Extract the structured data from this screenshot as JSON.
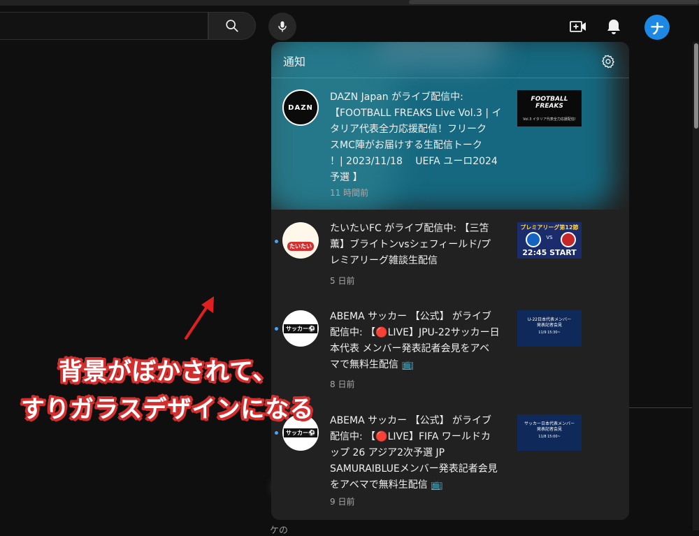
{
  "header": {
    "search_icon": "search-icon",
    "mic_icon": "mic-icon",
    "create_icon": "video-plus-icon",
    "bell_icon": "bell-icon",
    "avatar_initial": "ナ",
    "avatar_color": "#1e88e5"
  },
  "panel": {
    "title": "通知",
    "settings_icon": "gear-icon",
    "notifications": [
      {
        "text": "DAZN Japan がライブ配信中:\n【FOOTBALL FREAKS Live Vol.3 | イ\nタリア代表全力応援配信！フリーク\nスMC陣がお届けする生配信トーク\n！| 2023/11/18　 UEFA ユーロ2024\n予選 】",
        "time": "11 時間前",
        "unread": false,
        "avatar_text": "DAZN",
        "thumb_title": "FOOTBALL\nFREAKS",
        "thumb_sub": "Vol.3 イタリア代表全力応援配信!"
      },
      {
        "text": "たいたいFC がライブ配信中: 【三笘\n薫】ブライトンvsシェフィールド/プ\nレミアリーグ雑談生配信",
        "time": "5 日前",
        "unread": true,
        "avatar_text": "たいたい",
        "thumb_title": "プレミアリーグ第12節",
        "thumb_sub": "22:45 START",
        "thumb_vs": "VS"
      },
      {
        "text": "ABEMA サッカー 【公式】 がライブ\n配信中: 【🔴LIVE】JPU-22サッカー日\n本代表 メンバー発表記者会見をアベ\nマで無料生配信 📺",
        "time": "8 日前",
        "unread": true,
        "avatar_text": "サッカー⚽",
        "thumb_title": "U-22日本代表メンバー\n発表記者会見",
        "thumb_sub": "11/9 15:30~"
      },
      {
        "text": "ABEMA サッカー 【公式】 がライブ\n配信中: 【🔴LIVE】FIFA ワールドカ\nップ 26 アジア2次予選 JP\nSAMURAIBLUEメンバー発表記者会見\nをアベマで無料生配信 📺",
        "time": "9 日前",
        "unread": true,
        "avatar_text": "サッカー⚽",
        "thumb_title": "サッカー日本代表メンバー\n発表記者会見",
        "thumb_sub": "11/8 15:00~"
      }
    ]
  },
  "annotation": {
    "line1": "背景がぼかされて、",
    "line2": "すりガラスデザインになる",
    "color": "#d32f2f"
  },
  "background": {
    "snippet": "ケの"
  }
}
